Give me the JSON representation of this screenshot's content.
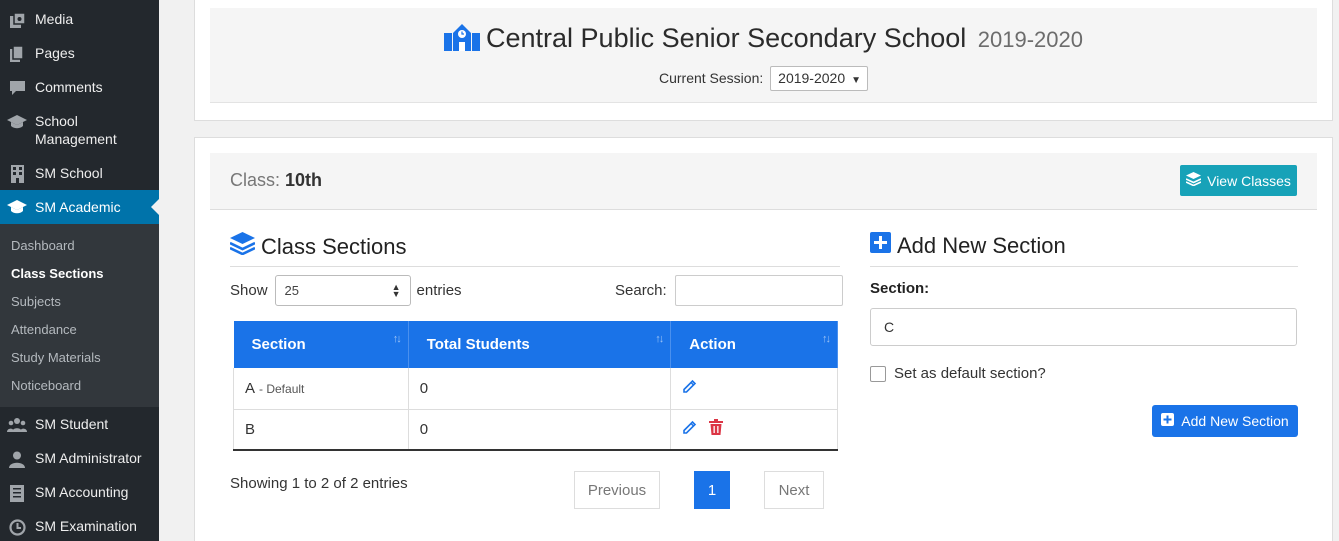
{
  "sidebar": {
    "items": [
      {
        "label": "Media",
        "icon": "media-icon"
      },
      {
        "label": "Pages",
        "icon": "pages-icon"
      },
      {
        "label": "Comments",
        "icon": "comments-icon"
      },
      {
        "label": "School Management",
        "icon": "graduation-cap-icon"
      },
      {
        "label": "SM School",
        "icon": "building-icon"
      },
      {
        "label": "SM Academic",
        "icon": "graduation-cap-icon"
      },
      {
        "label": "SM Student",
        "icon": "users-icon"
      },
      {
        "label": "SM Administrator",
        "icon": "user-icon"
      },
      {
        "label": "SM Accounting",
        "icon": "ledger-icon"
      },
      {
        "label": "SM Examination",
        "icon": "clock-icon"
      }
    ],
    "active_item": "SM Academic",
    "submenu": [
      "Dashboard",
      "Class Sections",
      "Subjects",
      "Attendance",
      "Study Materials",
      "Noticeboard"
    ],
    "current_submenu": "Class Sections"
  },
  "header": {
    "school_name": "Central Public Senior Secondary School",
    "year": "2019-2020",
    "session_label": "Current Session:",
    "session_value": "2019-2020"
  },
  "class_bar": {
    "label": "Class:",
    "value": "10th",
    "view_classes_label": "View Classes"
  },
  "sections_panel": {
    "title": "Class Sections",
    "show_label": "Show",
    "page_length": "25",
    "entries_label": "entries",
    "search_label": "Search:",
    "search_value": "",
    "columns": [
      "Section",
      "Total Students",
      "Action"
    ],
    "rows": [
      {
        "section": "A",
        "default_tag": "- Default",
        "total_students": "0",
        "actions": [
          "edit"
        ]
      },
      {
        "section": "B",
        "default_tag": "",
        "total_students": "0",
        "actions": [
          "edit",
          "delete"
        ]
      }
    ],
    "info": "Showing 1 to 2 of 2 entries",
    "pagination": {
      "previous": "Previous",
      "current_page": "1",
      "next": "Next"
    }
  },
  "add_panel": {
    "title": "Add New Section",
    "section_label": "Section:",
    "section_value": "C",
    "default_checkbox_label": "Set as default section?",
    "default_checked": false,
    "submit_label": "Add New Section"
  },
  "colors": {
    "sidebar_bg": "#23282d",
    "sidebar_active": "#0073aa",
    "primary": "#1a73e8",
    "info": "#17a2b8",
    "danger": "#dc3545"
  }
}
